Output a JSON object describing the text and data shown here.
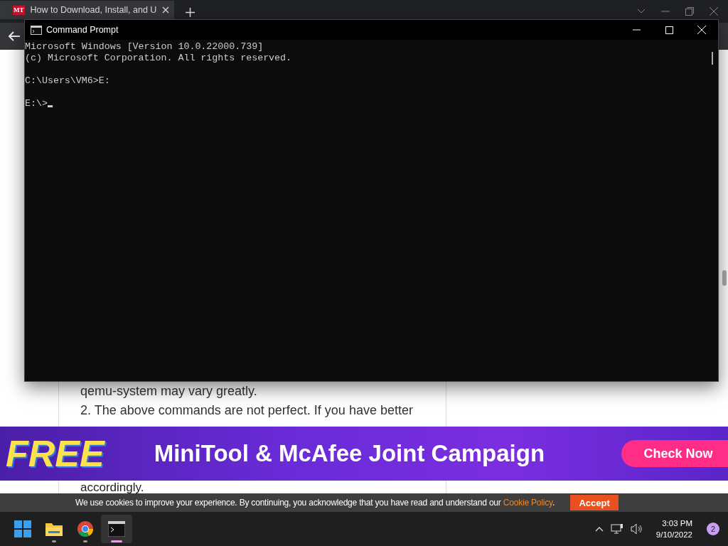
{
  "browser": {
    "tab": {
      "favicon": "MT",
      "title": "How to Download, Install, and U"
    }
  },
  "article": {
    "lines": [
      "qemu-system may vary greatly.",
      "2. The above commands are not perfect. If you have better"
    ],
    "last_line": "accordingly."
  },
  "banner": {
    "badge": "FREE",
    "title": "MiniTool & McAfee Joint Campaign",
    "button": "Check Now"
  },
  "cookie_bar": {
    "text": "We use cookies to improve your experience. By continuing, you acknowledge that you have read and understand our ",
    "link": "Cookie Policy",
    "suffix": ".",
    "button": "Accept"
  },
  "console": {
    "title": "Command Prompt",
    "paragraphs": [
      [
        "Microsoft Windows [Version 10.0.22000.739]",
        "(c) Microsoft Corporation. All rights reserved."
      ],
      [
        "C:\\Users\\VM6>E:"
      ],
      [
        "E:\\>"
      ]
    ]
  },
  "taskbar": {
    "apps": [
      {
        "kind": "start",
        "selected": false
      },
      {
        "kind": "explorer",
        "selected": false
      },
      {
        "kind": "chrome",
        "selected": false
      },
      {
        "kind": "terminal",
        "selected": true
      }
    ],
    "time": "3:03 PM",
    "date": "9/10/2022",
    "notifications": "2"
  }
}
